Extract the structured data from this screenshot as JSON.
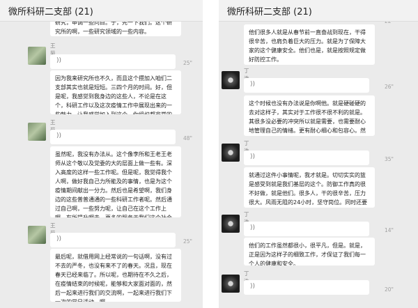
{
  "group_title": "微所科研二支部 (21)",
  "left_panel": {
    "top_fragment": "研究，申调一些问目。于，先一下我们。这个研究所的啊，一些研究领域的一些内容。",
    "messages": [
      {
        "sender": "王菊",
        "duration": "25\"",
        "text": "因为我来研究所也不久，而且这个攒加入咱们二支部其实也就是短短。三四个月的时间。好，但是呢，我感觉到我身边的这些人，不论是在这个，科研工作以及这次疫情工作中展现出来的一些魅力，让我感觉加入到这个。你组织都非常的啊，光荣。"
      },
      {
        "sender": "王菊",
        "duration": "48\"",
        "text": "虽然呢，我没有办法从。这个像李所和王老王老师从这个敬以及党委的大的层面上做一些有。深入高度的这样一些工作呢。但是呢，我觉得我个人啊，做好我自己力所能及的事情，也是为这个疫情期间献出一分力。然后也是希望啊，我们身边的这些普普通通的一些科研工作者呢。然后通过自己啊，一些努力呢，让自己在这个工作上啊，有所提升啊去。更多的服务于我们这个社会的点点滴滴啊，也是。展现自己的一点光彩吧。"
      },
      {
        "sender": "王菊",
        "duration": "25\"",
        "text": "最后呢，就借用网上经常说的一句话啊，没有过不去的严冬，也没有来不了的春天。况且，现在春天已经来临了。所以呢，也期待在不久之后，在疫情结束的时候呢，能够和大家面对面的，然后一起来进行我们的交流啊，一起来进行我们下一次的党日活动。啊"
      }
    ]
  },
  "right_panel": {
    "top_fragment": "他们很多人就是从春节前一直奋战到现在，干得很辛苦，也肩负着巨大的压力。就是为了保障大家的这个健康安全。他们也是，就是按照规定做好防控工作。",
    "top_duration": "22\"",
    "messages": [
      {
        "sender": "丁浩",
        "duration": "26\"",
        "text": "这个时候也没有办法说是你啊他。就是硬碰硬的去对这样子，其实对于工作很不很不利的就是。其很多没必要的冲突所以就是需要，也需要耐心地管理自己的情绪。更有耐心细心和包容心。然后才能够做好这个解释工作。"
      },
      {
        "sender": "丁浩",
        "duration": "35\"",
        "text": "就通过这件小事情呢，我才就是。切切实实的篮是感受到就是我们基层的这个。防御工作真的很不好做，就是他们。很多人，干的很辛苦，压力很大。风雨无阻的24小时，坚守岗位。同时还要承受群众的不理解和不理解。"
      },
      {
        "sender": "丁浩",
        "duration": "14\"",
        "text": "他们的工作虽然都很小，很平凡，但是。就是，正是因为这样子的细致工作，才保证了我们每一个人的健康和安全。"
      },
      {
        "sender": "丁浩",
        "duration": "20\""
      }
    ]
  }
}
